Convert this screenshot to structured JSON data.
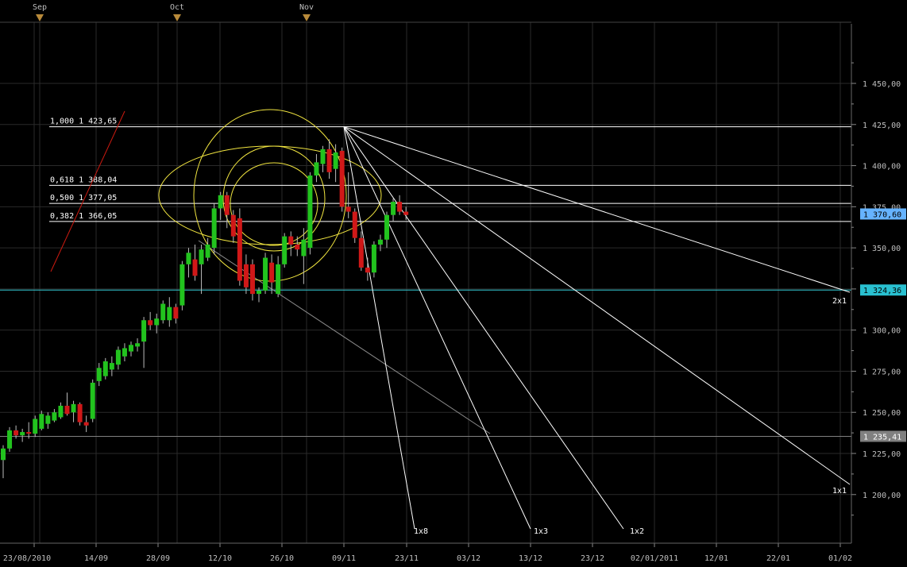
{
  "chart_data": {
    "type": "candlestick",
    "title": "",
    "month_markers": [
      "Sep",
      "Oct",
      "Nov"
    ],
    "x_tick_labels": [
      "23/08/2010",
      "14/09",
      "28/09",
      "12/10",
      "26/10",
      "09/11",
      "23/11",
      "03/12",
      "13/12",
      "23/12",
      "02/01/2011",
      "12/01",
      "22/01",
      "01/02"
    ],
    "y_tick_labels": [
      "1 200,00",
      "1 225,00",
      "1 250,00",
      "1 275,00",
      "1 300,00",
      "1 325,00",
      "1 350,00",
      "1 375,00",
      "1 400,00",
      "1 425,00",
      "1 450,00"
    ],
    "ylim": [
      1175,
      1475
    ],
    "y_ticks": [
      1200,
      1225,
      1250,
      1275,
      1300,
      1325,
      1350,
      1375,
      1400,
      1425,
      1450
    ],
    "grid": true,
    "candles": [
      {
        "o": 1221,
        "h": 1230,
        "l": 1210,
        "c": 1228
      },
      {
        "o": 1228,
        "h": 1241,
        "l": 1226,
        "c": 1239
      },
      {
        "o": 1239,
        "h": 1242,
        "l": 1234,
        "c": 1236
      },
      {
        "o": 1236,
        "h": 1240,
        "l": 1232,
        "c": 1238
      },
      {
        "o": 1238,
        "h": 1244,
        "l": 1234,
        "c": 1237
      },
      {
        "o": 1237,
        "h": 1248,
        "l": 1235,
        "c": 1246
      },
      {
        "o": 1240,
        "h": 1251,
        "l": 1239,
        "c": 1249
      },
      {
        "o": 1243,
        "h": 1250,
        "l": 1240,
        "c": 1248
      },
      {
        "o": 1245,
        "h": 1252,
        "l": 1244,
        "c": 1250
      },
      {
        "o": 1247,
        "h": 1256,
        "l": 1246,
        "c": 1254
      },
      {
        "o": 1254,
        "h": 1262,
        "l": 1248,
        "c": 1249
      },
      {
        "o": 1250,
        "h": 1257,
        "l": 1244,
        "c": 1255
      },
      {
        "o": 1255,
        "h": 1256,
        "l": 1242,
        "c": 1244
      },
      {
        "o": 1244,
        "h": 1248,
        "l": 1238,
        "c": 1242
      },
      {
        "o": 1246,
        "h": 1270,
        "l": 1244,
        "c": 1268
      },
      {
        "o": 1269,
        "h": 1280,
        "l": 1266,
        "c": 1277
      },
      {
        "o": 1272,
        "h": 1283,
        "l": 1270,
        "c": 1281
      },
      {
        "o": 1276,
        "h": 1284,
        "l": 1272,
        "c": 1280
      },
      {
        "o": 1279,
        "h": 1290,
        "l": 1276,
        "c": 1288
      },
      {
        "o": 1284,
        "h": 1292,
        "l": 1281,
        "c": 1289
      },
      {
        "o": 1287,
        "h": 1293,
        "l": 1284,
        "c": 1291
      },
      {
        "o": 1290,
        "h": 1295,
        "l": 1287,
        "c": 1292
      },
      {
        "o": 1293,
        "h": 1308,
        "l": 1277,
        "c": 1306
      },
      {
        "o": 1306,
        "h": 1311,
        "l": 1300,
        "c": 1303
      },
      {
        "o": 1303,
        "h": 1310,
        "l": 1298,
        "c": 1307
      },
      {
        "o": 1306,
        "h": 1318,
        "l": 1304,
        "c": 1316
      },
      {
        "o": 1306,
        "h": 1320,
        "l": 1302,
        "c": 1314
      },
      {
        "o": 1314,
        "h": 1316,
        "l": 1304,
        "c": 1307
      },
      {
        "o": 1315,
        "h": 1342,
        "l": 1312,
        "c": 1340
      },
      {
        "o": 1340,
        "h": 1350,
        "l": 1332,
        "c": 1347
      },
      {
        "o": 1343,
        "h": 1352,
        "l": 1330,
        "c": 1333
      },
      {
        "o": 1340,
        "h": 1352,
        "l": 1322,
        "c": 1349
      },
      {
        "o": 1344,
        "h": 1356,
        "l": 1342,
        "c": 1352
      },
      {
        "o": 1350,
        "h": 1377,
        "l": 1346,
        "c": 1374
      },
      {
        "o": 1374,
        "h": 1384,
        "l": 1367,
        "c": 1382
      },
      {
        "o": 1382,
        "h": 1384,
        "l": 1362,
        "c": 1370
      },
      {
        "o": 1370,
        "h": 1373,
        "l": 1353,
        "c": 1357
      },
      {
        "o": 1368,
        "h": 1374,
        "l": 1327,
        "c": 1330
      },
      {
        "o": 1340,
        "h": 1346,
        "l": 1322,
        "c": 1326
      },
      {
        "o": 1340,
        "h": 1343,
        "l": 1318,
        "c": 1322
      },
      {
        "o": 1322,
        "h": 1326,
        "l": 1317,
        "c": 1324
      },
      {
        "o": 1324,
        "h": 1347,
        "l": 1322,
        "c": 1344
      },
      {
        "o": 1341,
        "h": 1346,
        "l": 1322,
        "c": 1329
      },
      {
        "o": 1322,
        "h": 1345,
        "l": 1320,
        "c": 1340
      },
      {
        "o": 1340,
        "h": 1359,
        "l": 1338,
        "c": 1357
      },
      {
        "o": 1357,
        "h": 1360,
        "l": 1345,
        "c": 1352
      },
      {
        "o": 1352,
        "h": 1357,
        "l": 1345,
        "c": 1349
      },
      {
        "o": 1345,
        "h": 1362,
        "l": 1328,
        "c": 1355
      },
      {
        "o": 1350,
        "h": 1396,
        "l": 1346,
        "c": 1394
      },
      {
        "o": 1394,
        "h": 1407,
        "l": 1390,
        "c": 1402
      },
      {
        "o": 1401,
        "h": 1412,
        "l": 1396,
        "c": 1410
      },
      {
        "o": 1410,
        "h": 1416,
        "l": 1392,
        "c": 1396
      },
      {
        "o": 1398,
        "h": 1413,
        "l": 1390,
        "c": 1408
      },
      {
        "o": 1409,
        "h": 1411,
        "l": 1372,
        "c": 1375
      },
      {
        "o": 1375,
        "h": 1396,
        "l": 1368,
        "c": 1372
      },
      {
        "o": 1372,
        "h": 1374,
        "l": 1353,
        "c": 1356
      },
      {
        "o": 1356,
        "h": 1360,
        "l": 1336,
        "c": 1338
      },
      {
        "o": 1338,
        "h": 1344,
        "l": 1330,
        "c": 1335
      },
      {
        "o": 1335,
        "h": 1354,
        "l": 1332,
        "c": 1352
      },
      {
        "o": 1352,
        "h": 1358,
        "l": 1348,
        "c": 1355
      },
      {
        "o": 1355,
        "h": 1372,
        "l": 1350,
        "c": 1370
      },
      {
        "o": 1370,
        "h": 1380,
        "l": 1366,
        "c": 1378
      },
      {
        "o": 1378,
        "h": 1382,
        "l": 1370,
        "c": 1372
      },
      {
        "o": 1372,
        "h": 1375,
        "l": 1367,
        "c": 1370
      }
    ],
    "colors": {
      "background": "#000000",
      "grid": "#2a2a2a",
      "up": "#22c31e",
      "down": "#d01818",
      "fib": "#ffffff",
      "arc": "#f2e640",
      "fan": "#ffffff",
      "trend": "#cc1a10",
      "support": "#32c8d2",
      "level_gray": "#808080",
      "badge_price": "#66b3ff",
      "badge_support": "#29c0d0",
      "badge_gray": "#808080"
    },
    "fib_levels": [
      {
        "label": "1,000 1 423,65",
        "value": 1423.65
      },
      {
        "label": "0,618 1 388,04",
        "value": 1388.04
      },
      {
        "label": "0,500 1 377,05",
        "value": 1377.05
      },
      {
        "label": "0,382 1 366,05",
        "value": 1366.05
      }
    ],
    "horizontal_levels": [
      {
        "label": "1 324,36",
        "value": 1324.36,
        "color": "support"
      },
      {
        "label": "1 235,41",
        "value": 1235.41,
        "color": "level_gray"
      }
    ],
    "last_price": {
      "label": "1 370,60",
      "value": 1370.6
    },
    "gann_fan_labels": [
      "2x1",
      "1x1",
      "1x2",
      "1x3",
      "1x8"
    ]
  }
}
